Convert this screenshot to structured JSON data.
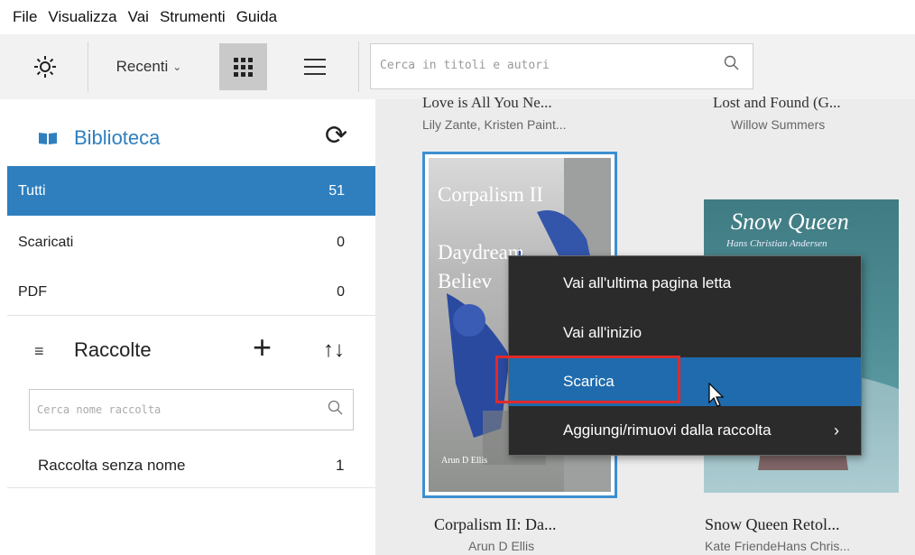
{
  "menubar": {
    "items": [
      "File",
      "Visualizza",
      "Vai",
      "Strumenti",
      "Guida"
    ]
  },
  "toolbar": {
    "sort_label": "Recenti",
    "search_placeholder": "Cerca in titoli e autori"
  },
  "sidebar": {
    "library_title": "Biblioteca",
    "categories": [
      {
        "label": "Tutti",
        "count": "51",
        "active": true
      },
      {
        "label": "Scaricati",
        "count": "0",
        "active": false
      },
      {
        "label": "PDF",
        "count": "0",
        "active": false
      }
    ],
    "collections_title": "Raccolte",
    "collection_search_placeholder": "Cerca nome raccolta",
    "collections": [
      {
        "label": "Raccolta senza nome",
        "count": "1"
      }
    ]
  },
  "grid": {
    "top_row": [
      {
        "title": "Love is All You Ne...",
        "author": "Lily Zante, Kristen Paint..."
      },
      {
        "title": "Lost and Found (G...",
        "author": "Willow Summers"
      }
    ],
    "books": [
      {
        "title": "Corpalism II: Da...",
        "author": "Arun D Ellis",
        "cover_lines": [
          "Corpalism II",
          "Daydream",
          "Believ"
        ],
        "cover_author": "Arun D Ellis",
        "selected": true
      },
      {
        "title": "Snow Queen Retol...",
        "author": "Kate FriendeHans Chris...",
        "cover_lines": [
          "Snow Queen"
        ],
        "cover_author": "Hans Christian Andersen",
        "selected": false
      }
    ]
  },
  "context_menu": {
    "items": [
      {
        "label": "Vai all'ultima pagina letta"
      },
      {
        "label": "Vai all'inizio"
      },
      {
        "label": "Scarica",
        "highlighted": true
      },
      {
        "label": "Aggiungi/rimuovi dalla raccolta",
        "submenu": true
      }
    ]
  },
  "colors": {
    "accent": "#2f7fbf",
    "highlight_box": "#e12a2a",
    "menu_bg": "#2b2b2b"
  }
}
